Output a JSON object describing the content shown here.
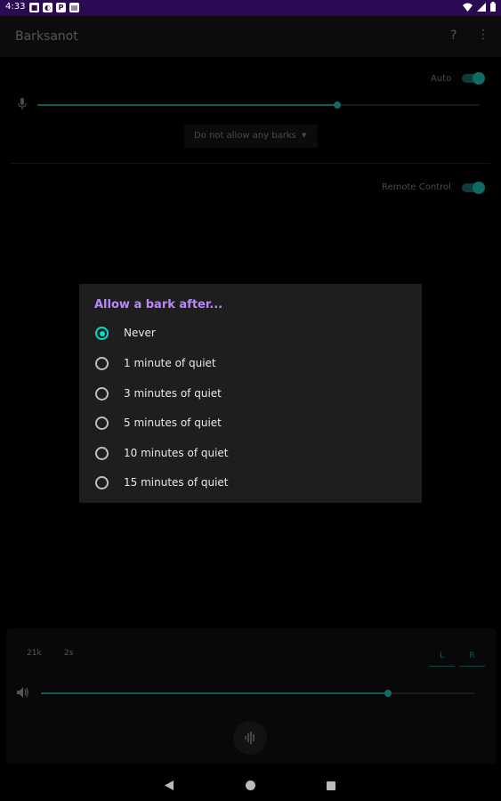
{
  "status_bar": {
    "time": "4:33"
  },
  "app_bar": {
    "title": "Barksanot",
    "help_label": "?",
    "more_icon": "more-vert-icon"
  },
  "controls": {
    "auto_label": "Auto",
    "auto_on": true,
    "sensitivity_value": 0.76,
    "bark_policy_selected": "Do not allow any barks",
    "remote_control_label": "Remote Control",
    "remote_control_on": true
  },
  "dialog": {
    "title": "Allow a bark after...",
    "options": [
      {
        "label": "Never",
        "checked": true
      },
      {
        "label": "1 minute of quiet",
        "checked": false
      },
      {
        "label": "3 minutes of quiet",
        "checked": false
      },
      {
        "label": "5 minutes of quiet",
        "checked": false
      },
      {
        "label": "10 minutes of quiet",
        "checked": false
      },
      {
        "label": "15 minutes of quiet",
        "checked": false
      }
    ]
  },
  "bottom_panel": {
    "sample_rate": "21k",
    "duration": "2s",
    "left_label": "L",
    "right_label": "R",
    "volume_value": 0.81
  },
  "colors": {
    "accent": "#03dac5",
    "dialog_title": "#bb86fc",
    "dim_accent": "#0f6b63"
  }
}
